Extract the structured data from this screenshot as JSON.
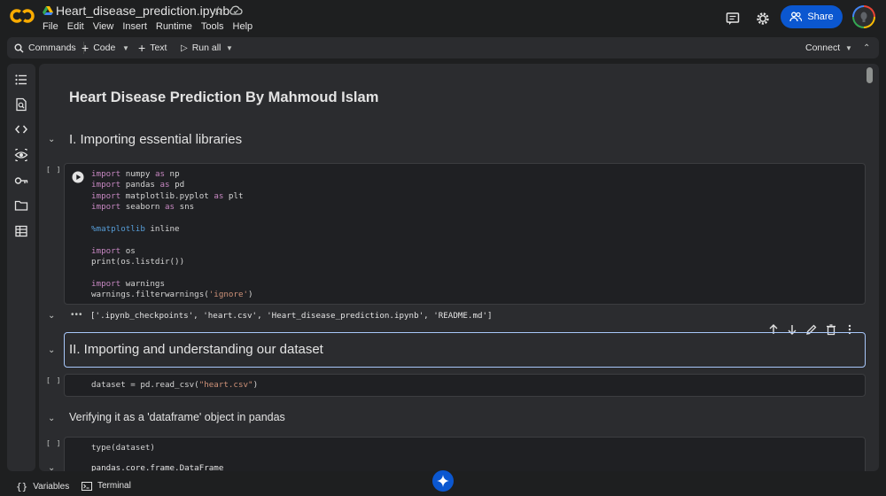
{
  "app": {
    "notebook_title": "Heart_disease_prediction.ipynb",
    "menu": [
      "File",
      "Edit",
      "View",
      "Insert",
      "Runtime",
      "Tools",
      "Help"
    ],
    "share_label": "Share"
  },
  "toolbar": {
    "commands_label": "Commands",
    "code_label": "Code",
    "text_label": "Text",
    "run_all_label": "Run all",
    "connect_label": "Connect"
  },
  "notebook": {
    "heading1": "Heart Disease Prediction By Mahmoud Islam",
    "section1": "I. Importing essential libraries",
    "bracket": "[ ]",
    "output_dots": "•••",
    "output1": "['.ipynb_checkpoints', 'heart.csv', 'Heart_disease_prediction.ipynb', 'README.md']",
    "section2": "II. Importing and understanding our dataset",
    "code2": "dataset = pd.read_csv(\"heart.csv\")",
    "section3": "Verifying it as a 'dataframe' object in pandas",
    "code3": "type(dataset)",
    "output3_partial": "pandas.core.frame.DataFrame"
  },
  "statusbar": {
    "variables_label": "Variables",
    "terminal_label": "Terminal"
  },
  "colors": {
    "accent": "#0b57d0",
    "background": "#1e1f20",
    "panel": "#2b2c2f",
    "selection_border": "#a8c7fa"
  }
}
